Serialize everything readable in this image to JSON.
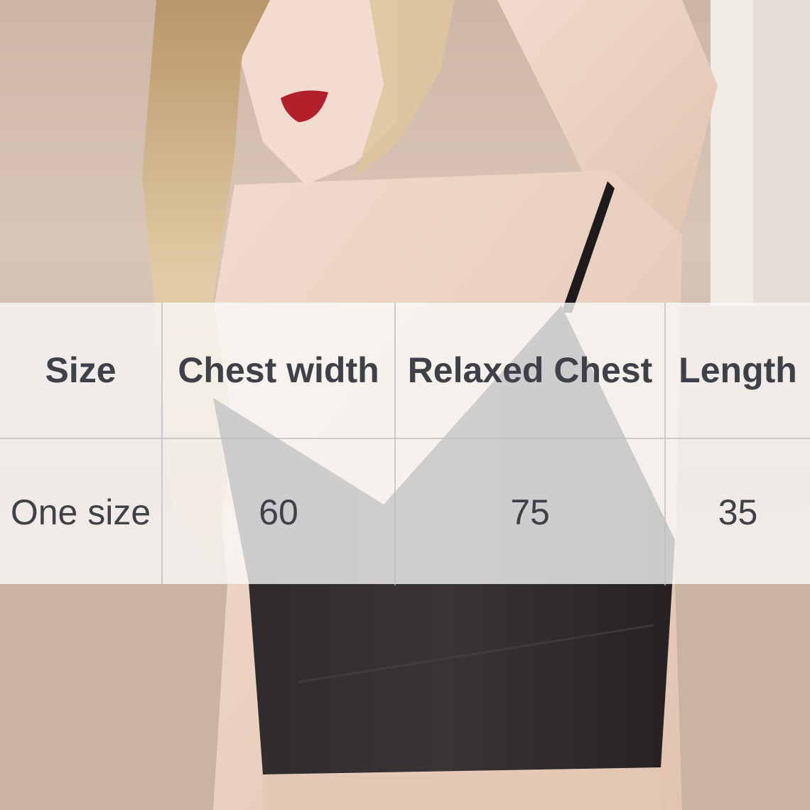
{
  "size_chart": {
    "columns": [
      "Size",
      "Chest width",
      "Relaxed Chest",
      "Length"
    ],
    "rows": [
      [
        "One size",
        "60",
        "75",
        "35"
      ]
    ]
  },
  "colors": {
    "text": "#3f4148",
    "top_garment": "#2a2527",
    "lips": "#b3202c",
    "hair": "#d8bf95",
    "skin": "#ecd2c2"
  }
}
